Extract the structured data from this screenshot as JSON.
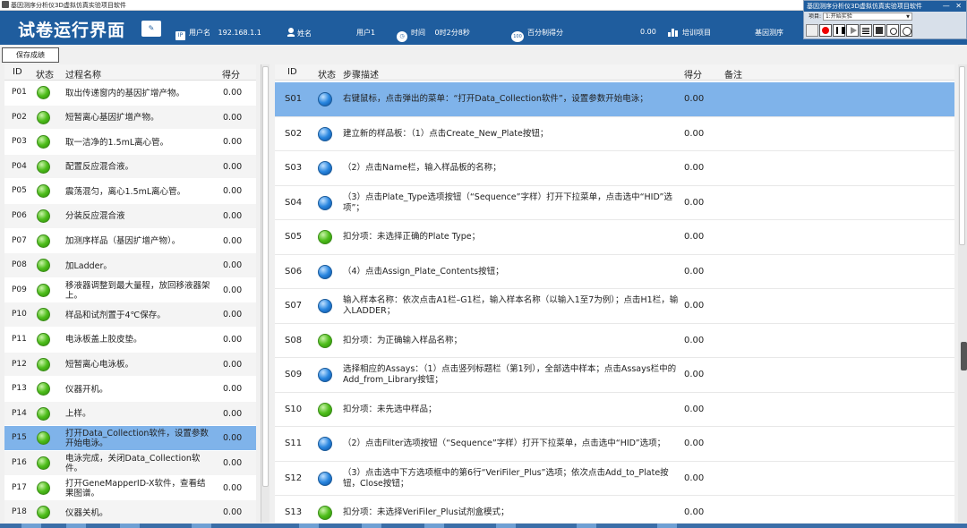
{
  "window_title": "基因测序分析仪3D虚拟仿真实验项目软件",
  "header": {
    "title": "试卷运行界面",
    "ip_icon": "IP",
    "username_label": "用户名",
    "ip": "192.168.1.1",
    "name_label": "姓名",
    "user": "用户1",
    "time_label": "时间",
    "time": "0时2分8秒",
    "percent_icon": "100",
    "percent_label": "百分制得分",
    "score": "0.00",
    "training_label": "培训项目",
    "project": "基因测序"
  },
  "tool_panel": {
    "title": "基因测序分析仪3D虚拟仿真实验项目软件",
    "controls": "— ✕",
    "project_label": "项目:",
    "project_value": "1:开始实验"
  },
  "save_button": "保存成绩",
  "process_table": {
    "headers": [
      "ID",
      "状态",
      "过程名称",
      "得分"
    ],
    "rows": [
      {
        "id": "P01",
        "name": "取出传递窗内的基因扩增产物。",
        "score": "0.00"
      },
      {
        "id": "P02",
        "name": "短暂离心基因扩增产物。",
        "score": "0.00"
      },
      {
        "id": "P03",
        "name": "取一洁净的1.5mL离心管。",
        "score": "0.00"
      },
      {
        "id": "P04",
        "name": "配置反应混合液。",
        "score": "0.00"
      },
      {
        "id": "P05",
        "name": "震荡混匀，离心1.5mL离心管。",
        "score": "0.00"
      },
      {
        "id": "P06",
        "name": "分装反应混合液",
        "score": "0.00"
      },
      {
        "id": "P07",
        "name": "加测序样品（基因扩增产物）。",
        "score": "0.00"
      },
      {
        "id": "P08",
        "name": "加Ladder。",
        "score": "0.00"
      },
      {
        "id": "P09",
        "name": "移液器调整到最大量程，放回移液器架上。",
        "score": "0.00"
      },
      {
        "id": "P10",
        "name": "样品和试剂置于4℃保存。",
        "score": "0.00"
      },
      {
        "id": "P11",
        "name": "电泳板盖上胶皮垫。",
        "score": "0.00"
      },
      {
        "id": "P12",
        "name": "短暂离心电泳板。",
        "score": "0.00"
      },
      {
        "id": "P13",
        "name": "仪器开机。",
        "score": "0.00"
      },
      {
        "id": "P14",
        "name": "上样。",
        "score": "0.00"
      },
      {
        "id": "P15",
        "name": "打开Data_Collection软件，设置参数开始电泳。",
        "score": "0.00"
      },
      {
        "id": "P16",
        "name": "电泳完成，关闭Data_Collection软件。",
        "score": "0.00"
      },
      {
        "id": "P17",
        "name": "打开GeneMapperID-X软件，查看结果图谱。",
        "score": "0.00"
      },
      {
        "id": "P18",
        "name": "仪器关机。",
        "score": "0.00"
      }
    ]
  },
  "step_table": {
    "headers": [
      "ID",
      "状态",
      "步骤描述",
      "得分",
      "备注"
    ],
    "rows": [
      {
        "id": "S01",
        "status": "blue",
        "desc": "右键鼠标，点击弹出的菜单：“打开Data_Collection软件”，设置参数开始电泳；",
        "score": "0.00"
      },
      {
        "id": "S02",
        "status": "blue",
        "desc": "建立新的样品板：（1）点击Create_New_Plate按钮；",
        "score": "0.00"
      },
      {
        "id": "S03",
        "status": "blue",
        "desc": "（2）点击Name栏，输入样品板的名称；",
        "score": "0.00"
      },
      {
        "id": "S04",
        "status": "blue",
        "desc": "（3）点击Plate_Type选项按钮（“Sequence”字样）打开下拉菜单，点击选中“HID”选项”；",
        "score": "0.00"
      },
      {
        "id": "S05",
        "status": "green",
        "desc": "扣分项：未选择正确的Plate Type；",
        "score": "0.00"
      },
      {
        "id": "S06",
        "status": "blue",
        "desc": "（4）点击Assign_Plate_Contents按钮；",
        "score": "0.00"
      },
      {
        "id": "S07",
        "status": "blue",
        "desc": "输入样本名称：依次点击A1栏–G1栏，输入样本名称（以输入1至7为例）；点击H1栏，输入LADDER；",
        "score": "0.00"
      },
      {
        "id": "S08",
        "status": "green",
        "desc": "扣分项：为正确输入样品名称；",
        "score": "0.00"
      },
      {
        "id": "S09",
        "status": "blue",
        "desc": "选择相应的Assays：（1）点击竖列标题栏（第1列），全部选中样本；点击Assays栏中的Add_from_Library按钮；",
        "score": "0.00"
      },
      {
        "id": "S10",
        "status": "green",
        "desc": "扣分项：未先选中样品；",
        "score": "0.00"
      },
      {
        "id": "S11",
        "status": "blue",
        "desc": "（2）点击Filter选项按钮（“Sequence”字样）打开下拉菜单，点击选中“HID”选项；",
        "score": "0.00"
      },
      {
        "id": "S12",
        "status": "blue",
        "desc": "（3）点击选中下方选项框中的第6行“VeriFiler_Plus”选项；依次点击Add_to_Plate按钮，Close按钮；",
        "score": "0.00"
      },
      {
        "id": "S13",
        "status": "green",
        "desc": "扣分项：未选择VeriFiler_Plus试剂盒模式；",
        "score": "0.00"
      }
    ]
  }
}
